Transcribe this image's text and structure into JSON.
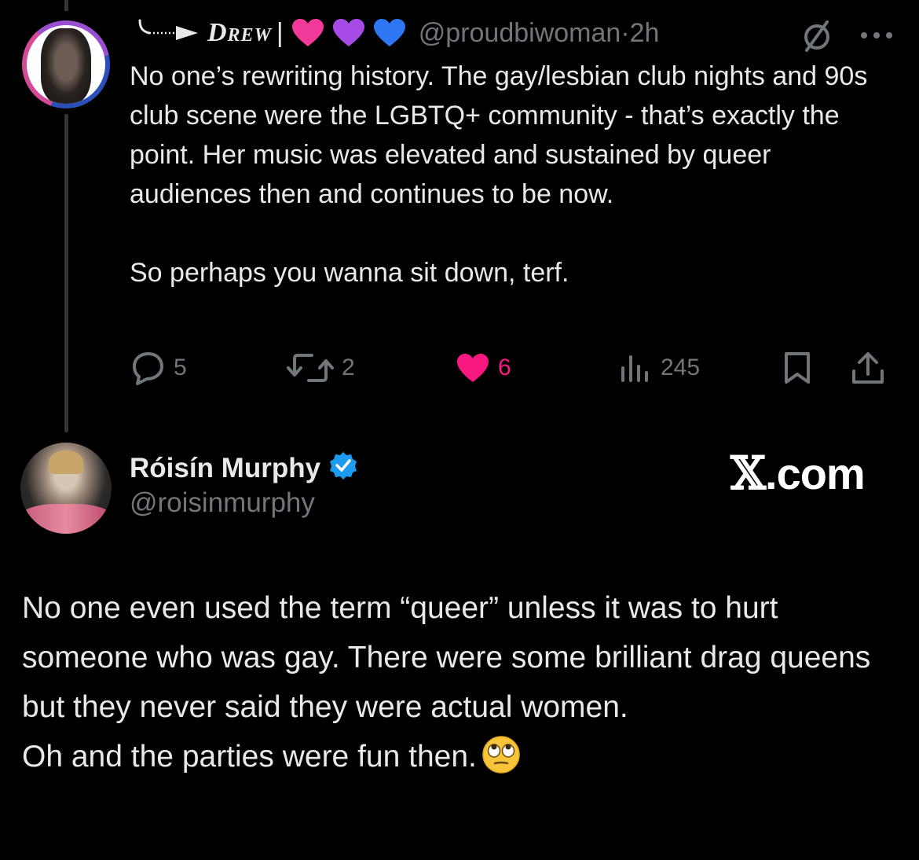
{
  "reply_tweet": {
    "display_name": "Drew",
    "handle": "@proudbiwoman",
    "separator": "·",
    "time": "2h",
    "heart_colors": [
      "#f23a9a",
      "#a74be8",
      "#2f76f5"
    ],
    "paragraphs": [
      "No one’s rewriting history. The gay/lesbian club nights and 90s club scene were the LGBTQ+ community - that’s exactly the point. Her music was elevated and sustained by queer audiences then and continues to be now.",
      "So perhaps you wanna sit down, terf."
    ],
    "actions": {
      "replies": "5",
      "reposts": "2",
      "likes": "6",
      "views": "245"
    },
    "icons": [
      "reply-icon",
      "repost-icon",
      "like-icon",
      "views-icon",
      "bookmark-icon",
      "share-icon",
      "mute-icon",
      "more-icon"
    ]
  },
  "quoted_tweet": {
    "display_name": "Róisín Murphy",
    "handle": "@roisinmurphy",
    "verified_color": "#1d9bf0",
    "brand": {
      "mark": "𝕏",
      "suffix": ".com"
    },
    "paragraphs": [
      "No one even used the term “queer” unless it was to hurt someone who was gay. There were some brilliant drag queens but they never said they were actual women.",
      "Oh and the parties were fun then."
    ],
    "trailing_emoji": "face-with-rolling-eyes"
  },
  "colors": {
    "background": "#000000",
    "text": "#e7e9ea",
    "muted": "#71767b",
    "like": "#f91880"
  }
}
